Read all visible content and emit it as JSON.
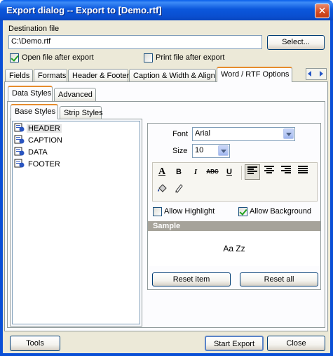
{
  "window": {
    "title": "Export dialog -- Export to [Demo.rtf]",
    "close_glyph": "✕"
  },
  "destination": {
    "label": "Destination file",
    "value": "C:\\Demo.rtf",
    "select_label": "Select...",
    "open_after_export": {
      "label": "Open file after export",
      "checked": true
    },
    "print_after_export": {
      "label": "Print file after export",
      "checked": false
    }
  },
  "main_tabs": [
    {
      "label": "Fields"
    },
    {
      "label": "Formats"
    },
    {
      "label": "Header & Footer"
    },
    {
      "label": "Caption & Width & Align"
    },
    {
      "label": "Word / RTF Options",
      "active": true
    }
  ],
  "sub_tabs": [
    {
      "label": "Data Styles",
      "active": true
    },
    {
      "label": "Advanced"
    }
  ],
  "style_tabs": [
    {
      "label": "Base Styles",
      "active": true
    },
    {
      "label": "Strip Styles"
    }
  ],
  "styles": [
    {
      "label": "HEADER",
      "selected": true
    },
    {
      "label": "CAPTION"
    },
    {
      "label": "DATA"
    },
    {
      "label": "FOOTER"
    }
  ],
  "font": {
    "label": "Font",
    "value": "Arial"
  },
  "size": {
    "label": "Size",
    "value": "10"
  },
  "format_tools": {
    "font_color": "A",
    "bold": "B",
    "italic": "I",
    "strike": "ABC",
    "underline": "U"
  },
  "allow_highlight": {
    "label": "Allow Highlight",
    "checked": false
  },
  "allow_background": {
    "label": "Allow Background",
    "checked": true
  },
  "sample": {
    "header": "Sample",
    "text": "Aa Zz"
  },
  "reset_item_label": "Reset item",
  "reset_all_label": "Reset all",
  "footer": {
    "tools": "Tools",
    "start_export": "Start Export",
    "close": "Close"
  },
  "colors": {
    "title_bar": "#0a4fd6",
    "sample_header": "#a6a39a",
    "active_tab_accent": "#e68b2c"
  }
}
